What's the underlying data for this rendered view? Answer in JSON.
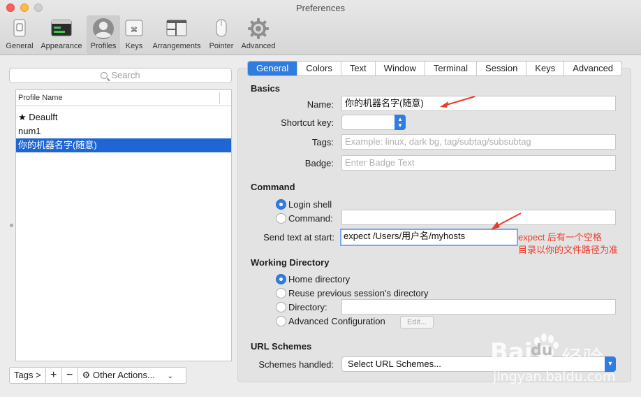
{
  "window": {
    "title": "Preferences"
  },
  "toolbar": {
    "items": [
      {
        "label": "General",
        "icon": "switch-icon"
      },
      {
        "label": "Appearance",
        "icon": "terminal-window-icon"
      },
      {
        "label": "Profiles",
        "icon": "person-icon",
        "selected": true
      },
      {
        "label": "Keys",
        "icon": "command-key-icon"
      },
      {
        "label": "Arrangements",
        "icon": "window-layout-icon"
      },
      {
        "label": "Pointer",
        "icon": "mouse-icon"
      },
      {
        "label": "Advanced",
        "icon": "gear-icon"
      }
    ]
  },
  "sidebar": {
    "search_placeholder": "Search",
    "column_header": "Profile Name",
    "profiles": [
      {
        "name": "★ Deaulft"
      },
      {
        "name": "num1"
      },
      {
        "name": "你的机器名字(随意)",
        "selected": true
      }
    ],
    "tags_button": "Tags >",
    "add_button": "+",
    "remove_button": "−",
    "other_actions": "Other Actions..."
  },
  "tabs": [
    "General",
    "Colors",
    "Text",
    "Window",
    "Terminal",
    "Session",
    "Keys",
    "Advanced"
  ],
  "active_tab": "General",
  "basics": {
    "title": "Basics",
    "name_label": "Name:",
    "name_value": "你的机器名字(随意)",
    "shortcut_label": "Shortcut key:",
    "tags_label": "Tags:",
    "tags_placeholder": "Example: linux, dark bg, tag/subtag/subsubtag",
    "badge_label": "Badge:",
    "badge_placeholder": "Enter Badge Text"
  },
  "command": {
    "title": "Command",
    "login_shell": "Login shell",
    "command_label": "Command:",
    "send_text_label": "Send text at start:",
    "send_text_value": "expect /Users/用户名/myhosts"
  },
  "working_directory": {
    "title": "Working Directory",
    "home": "Home directory",
    "reuse": "Reuse previous session's directory",
    "directory": "Directory:",
    "advanced": "Advanced Configuration",
    "edit_button": "Edit..."
  },
  "url_schemes": {
    "title": "URL Schemes",
    "label": "Schemes handled:",
    "select": "Select URL Schemes..."
  },
  "annotations": {
    "line1": "expect 后有一个空格",
    "line2": "目录以你的文件路径为准"
  },
  "watermark": {
    "brand": "Bai",
    "brand_suffix": "du",
    "cn": "经验",
    "url": "jingyan.baidu.com"
  },
  "colors": {
    "accent": "#2f7de1",
    "selection": "#1d66d4",
    "annotation": "#ee3a2b"
  }
}
